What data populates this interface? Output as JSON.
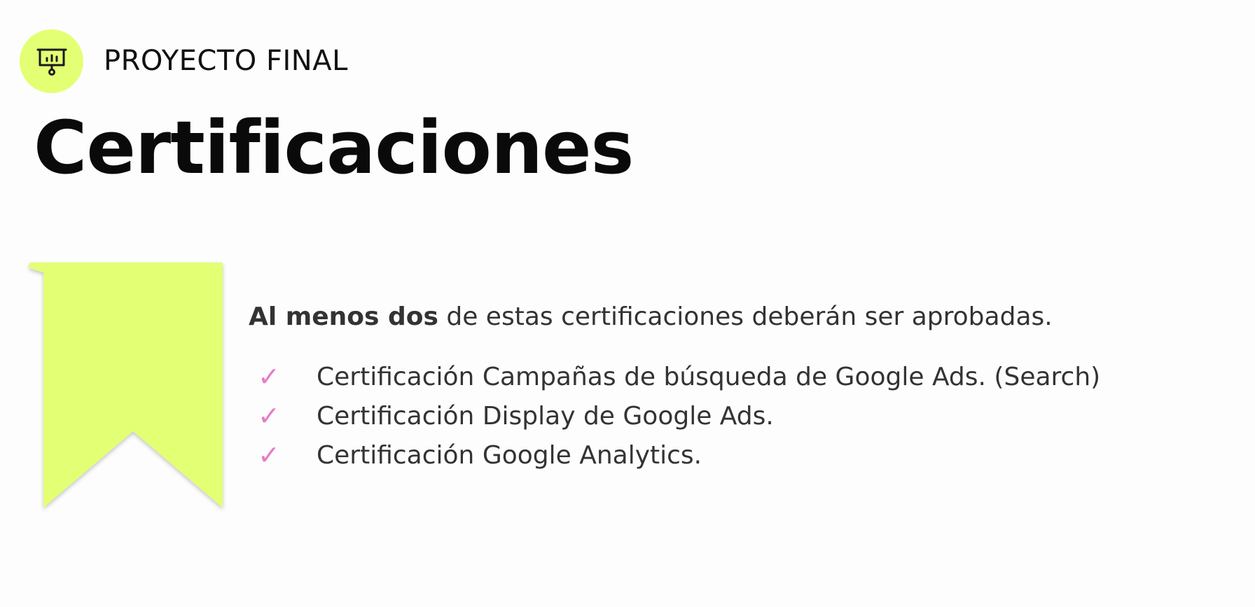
{
  "header": {
    "icon": "presentation-board-icon",
    "label": "PROYECTO FINAL",
    "accent_color": "#e3ff73"
  },
  "title": "Certificaciones",
  "ribbon": {
    "icon": "bookmark-ribbon",
    "color": "#e3ff73"
  },
  "intro": {
    "bold_text": "Al menos dos",
    "rest_text": " de estas certificaciones deberán ser aprobadas."
  },
  "certifications": {
    "check_icon": "checkmark-icon",
    "check_glyph": "✓",
    "check_color": "#e67ec6",
    "items": [
      "Certificación Campañas de búsqueda de Google Ads. (Search)",
      "Certificación Display de Google Ads.",
      "Certificación Google Analytics."
    ]
  }
}
